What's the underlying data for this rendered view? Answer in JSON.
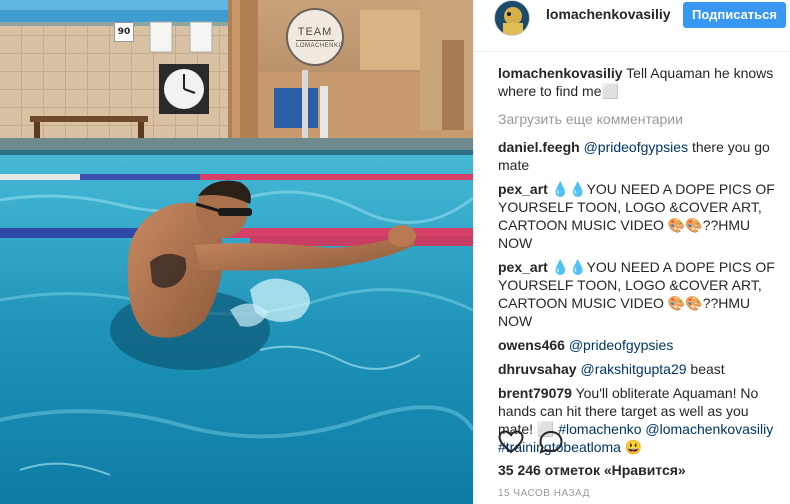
{
  "photo": {
    "alt_scene": "",
    "scoreboard_value": "90",
    "sign_line1": "TEAM",
    "sign_line2": "LOMACHENKO"
  },
  "header": {
    "username": "lomachenkovasiliy",
    "follow_label": "Подписаться"
  },
  "caption": {
    "author": "lomachenkovasiliy",
    "text": "Tell Aquaman he knows where to find me⬜"
  },
  "load_more_label": "Загрузить еще комментарии",
  "comments": [
    {
      "author": "daniel.feegh",
      "mention": "@prideofgypsies",
      "text": " there you go mate"
    },
    {
      "author": "pex_art",
      "mention": "",
      "text": "💧💧YOU NEED A DOPE PICS OF YOURSELF TOON, LOGO &COVER ART, CARTOON MUSIC VIDEO 🎨🎨??HMU NOW"
    },
    {
      "author": "pex_art",
      "mention": "",
      "text": "💧💧YOU NEED A DOPE PICS OF YOURSELF TOON, LOGO &COVER ART, CARTOON MUSIC VIDEO 🎨🎨??HMU NOW"
    },
    {
      "author": "owens466",
      "mention": "@prideofgypsies",
      "text": ""
    },
    {
      "author": "dhruvsahay",
      "mention": "@rakshitgupta29",
      "text": " beast"
    },
    {
      "author": "brent79079",
      "mention": "",
      "text": "You'll obliterate Aquaman! No hands can hit there target as well as you mate! ⬜ ",
      "tags": [
        "#lomachenko",
        " @lomachenkovasiliy",
        " #trainingtobeatloma"
      ],
      "trail": " 😃"
    }
  ],
  "actions": {
    "like_icon": "heart-icon",
    "comment_icon": "comment-icon"
  },
  "likes": {
    "count": "35 246",
    "label": "отметок «Нравится»"
  },
  "timestamp": "15 часов назад",
  "colors": {
    "follow": "#3897f0",
    "link": "#003569",
    "muted": "#999999"
  }
}
